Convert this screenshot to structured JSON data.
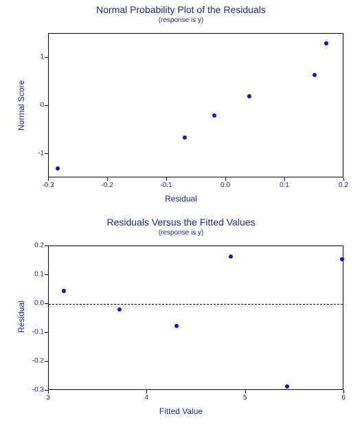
{
  "chart_data": [
    {
      "type": "scatter",
      "title": "Normal Probability Plot of the Residuals",
      "subtitle": "(response is y)",
      "xlabel": "Residual",
      "ylabel": "Normal Score",
      "xlim": [
        -0.3,
        0.2
      ],
      "ylim": [
        -1.5,
        1.5
      ],
      "xticks": [
        -0.3,
        -0.2,
        -0.1,
        0.0,
        0.1,
        0.2
      ],
      "yticks": [
        -1,
        0,
        1
      ],
      "series": [
        {
          "name": "residuals",
          "x": [
            -0.285,
            -0.07,
            -0.02,
            0.04,
            0.15,
            0.17
          ],
          "y": [
            -1.3,
            -0.65,
            -0.2,
            0.2,
            0.65,
            1.3
          ]
        }
      ]
    },
    {
      "type": "scatter",
      "title": "Residuals Versus the Fitted Values",
      "subtitle": "(response is y)",
      "xlabel": "Fitted Value",
      "ylabel": "Residual",
      "xlim": [
        3,
        6
      ],
      "ylim": [
        -0.3,
        0.2
      ],
      "xticks": [
        3,
        4,
        5,
        6
      ],
      "yticks": [
        -0.3,
        -0.2,
        -0.1,
        0.0,
        0.1,
        0.2
      ],
      "hline": 0.0,
      "series": [
        {
          "name": "residuals",
          "x": [
            3.15,
            3.72,
            4.3,
            4.85,
            5.42,
            5.98
          ],
          "y": [
            0.045,
            -0.02,
            -0.075,
            0.165,
            -0.285,
            0.155
          ]
        }
      ]
    }
  ]
}
